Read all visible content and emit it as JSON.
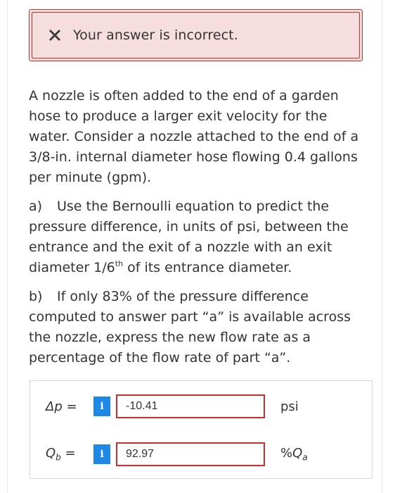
{
  "alert": {
    "message": "Your answer is incorrect.",
    "color": "#c9302c",
    "background": "#f7dede",
    "icon": "x-icon"
  },
  "problem": {
    "intro": "A nozzle is often added to the end of a garden hose to produce a larger exit velocity for the water. Consider a nozzle attached to the end of a 3/8-in. internal diameter hose flowing 0.4 gallons per minute (gpm).",
    "part_a": {
      "letter": "a)",
      "text_before_sup": "Use the Bernoulli equation to predict the pressure difference, in units of psi, between the entrance and the exit of a nozzle with an exit diameter 1/6",
      "sup": "th",
      "text_after_sup": " of its entrance diameter."
    },
    "part_b": {
      "letter": "b)",
      "text": "If only 83% of the pressure difference computed to answer part “a” is available across the nozzle, express the new flow rate as a percentage of the flow rate of part “a”."
    }
  },
  "answers": [
    {
      "label_symbol": "Δp",
      "label_sub": "",
      "label_eq": " =",
      "info": "i",
      "value": "-10.41",
      "unit_prefix": "psi",
      "unit_symbol": "",
      "unit_sub": ""
    },
    {
      "label_symbol": "Q",
      "label_sub": "b",
      "label_eq": " =",
      "info": "i",
      "value": "92.97",
      "unit_prefix": "%",
      "unit_symbol": "Q",
      "unit_sub": "a"
    }
  ],
  "colors": {
    "error": "#c9302c",
    "info_button": "#1e88e5",
    "text": "#333333"
  }
}
